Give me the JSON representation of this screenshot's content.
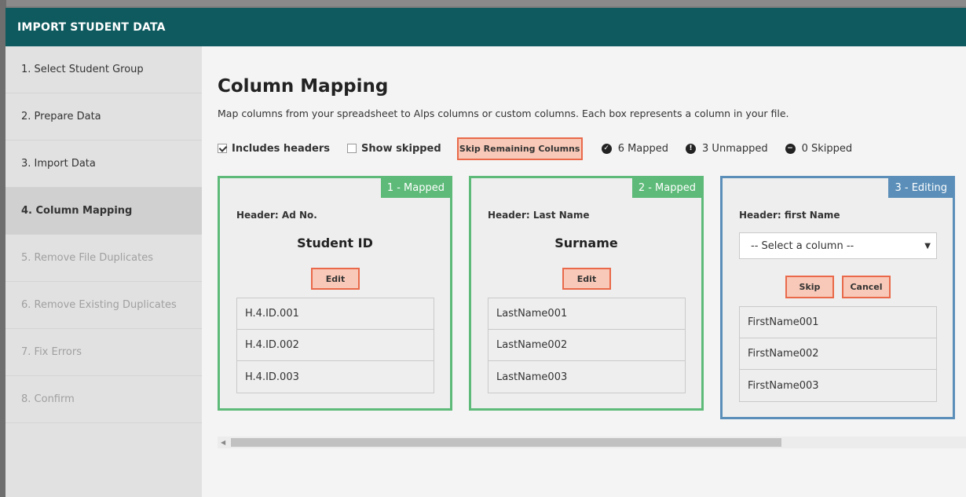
{
  "modal": {
    "title": "IMPORT STUDENT DATA"
  },
  "sidebar": {
    "steps": [
      {
        "label": "1. Select Student Group",
        "state": "done"
      },
      {
        "label": "2. Prepare Data",
        "state": "done"
      },
      {
        "label": "3. Import Data",
        "state": "done"
      },
      {
        "label": "4. Column Mapping",
        "state": "active"
      },
      {
        "label": "5. Remove File Duplicates",
        "state": "disabled"
      },
      {
        "label": "6. Remove Existing Duplicates",
        "state": "disabled"
      },
      {
        "label": "7. Fix Errors",
        "state": "disabled"
      },
      {
        "label": "8. Confirm",
        "state": "disabled"
      }
    ]
  },
  "main": {
    "title": "Column Mapping",
    "description": "Map columns from your spreadsheet to Alps columns or custom columns. Each box represents a column in your file.",
    "toolbar": {
      "includes_headers_label": "Includes headers",
      "includes_headers_checked": true,
      "show_skipped_label": "Show skipped",
      "show_skipped_checked": false,
      "skip_remaining_label": "Skip Remaining Columns",
      "mapped_label": "6 Mapped",
      "unmapped_label": "3 Unmapped",
      "skipped_label": "0 Skipped"
    },
    "cards": [
      {
        "badge": "1 - Mapped",
        "header": "Header: Ad No.",
        "column": "Student ID",
        "edit_label": "Edit",
        "values": [
          "H.4.ID.001",
          "H.4.ID.002",
          "H.4.ID.003"
        ]
      },
      {
        "badge": "2 - Mapped",
        "header": "Header: Last Name",
        "column": "Surname",
        "edit_label": "Edit",
        "values": [
          "LastName001",
          "LastName002",
          "LastName003"
        ]
      },
      {
        "badge": "3 - Editing",
        "header": "Header: first Name",
        "select_value": "-- Select a column --",
        "skip_label": "Skip",
        "cancel_label": "Cancel",
        "values": [
          "FirstName001",
          "FirstName002",
          "FirstName003"
        ]
      }
    ]
  },
  "colors": {
    "header_bg": "#0e5a5f",
    "mapped": "#5dba78",
    "editing": "#5b8fb9",
    "button_bg": "#f8c9b8",
    "button_border": "#e9694a"
  },
  "icons": {
    "mapped": "check-circle-icon",
    "unmapped": "exclamation-circle-icon",
    "skipped": "minus-circle-icon"
  }
}
